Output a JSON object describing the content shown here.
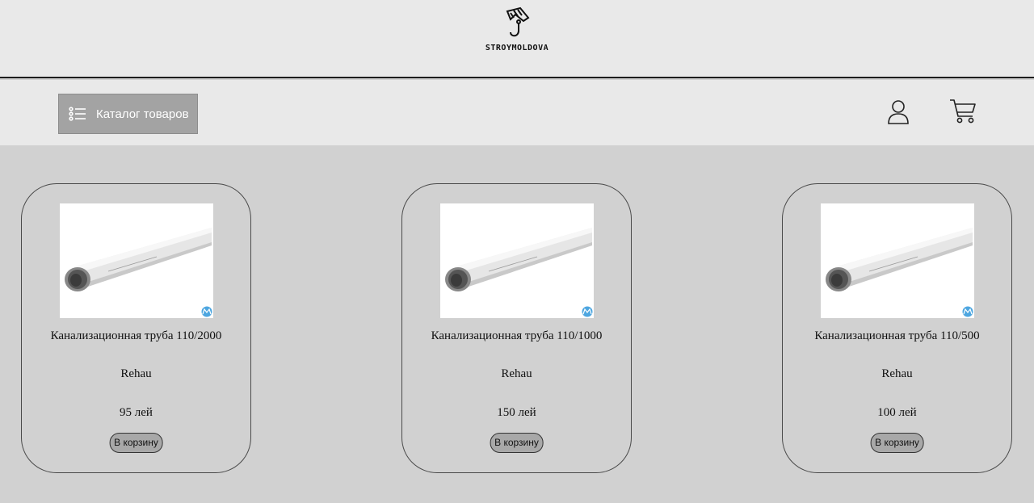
{
  "brand": {
    "logo_text": "STROYMOLDOVA",
    "logo_icon": "wrench-hook-icon"
  },
  "navbar": {
    "catalog_label": "Каталог товаров",
    "catalog_icon": "list-icon",
    "user_icon": "user-icon",
    "cart_icon": "cart-icon"
  },
  "products": [
    {
      "name": "Канализационная труба 110/2000",
      "brand": "Rehau",
      "price": "95 лей",
      "button": "В корзину"
    },
    {
      "name": "Канализационная труба 110/1000",
      "brand": "Rehau",
      "price": "150 лей",
      "button": "В корзину"
    },
    {
      "name": "Канализационная труба 110/500",
      "brand": "Rehau",
      "price": "100 лей",
      "button": "В корзину"
    }
  ],
  "colors": {
    "page_bg": "#d1d1d1",
    "header_bg": "#e9e9e9",
    "catalog_button_bg": "#a3a3a3",
    "cart_button_bg": "#a8a8a8"
  }
}
